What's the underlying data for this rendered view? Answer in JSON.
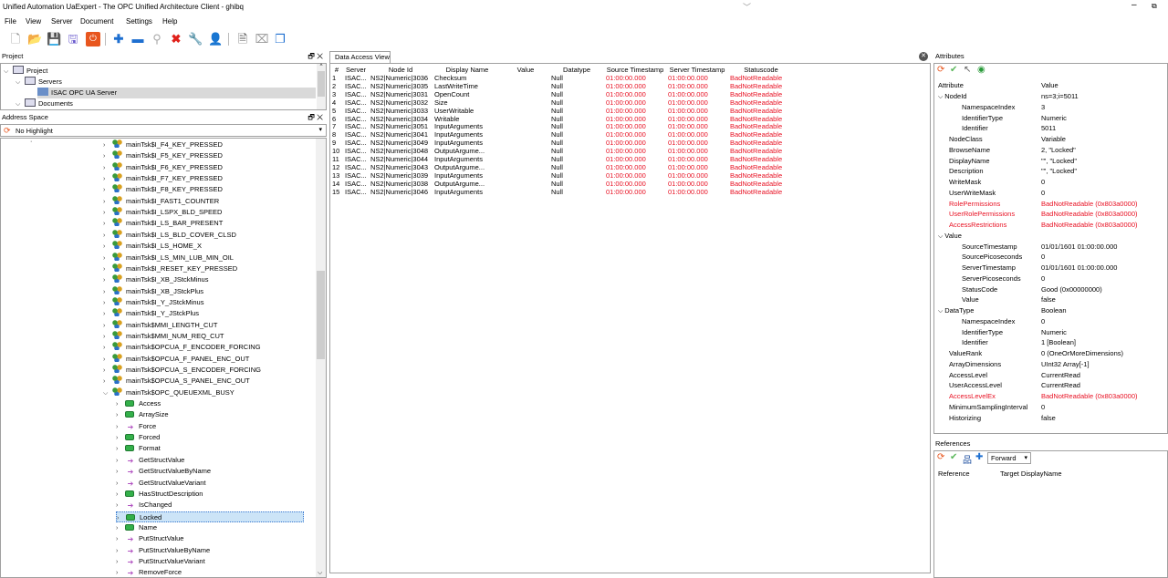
{
  "window": {
    "title": "Unified Automation UaExpert - The OPC Unified Architecture Client - ghibq"
  },
  "menu": [
    "File",
    "View",
    "Server",
    "Document",
    "Settings",
    "Help"
  ],
  "project_panel": {
    "title": "Project",
    "items": [
      {
        "label": "Project",
        "level": 0
      },
      {
        "label": "Servers",
        "level": 1
      },
      {
        "label": "ISAC OPC UA Server",
        "level": 2
      },
      {
        "label": "Documents",
        "level": 1
      }
    ]
  },
  "address_panel": {
    "title": "Address Space",
    "highlight": "No Highlight",
    "items": [
      {
        "label": "mainTsk$I_F4_KEY_PRESSED",
        "kind": "obj",
        "indent": 0
      },
      {
        "label": "mainTsk$I_F5_KEY_PRESSED",
        "kind": "obj",
        "indent": 0
      },
      {
        "label": "mainTsk$I_F6_KEY_PRESSED",
        "kind": "obj",
        "indent": 0
      },
      {
        "label": "mainTsk$I_F7_KEY_PRESSED",
        "kind": "obj",
        "indent": 0
      },
      {
        "label": "mainTsk$I_F8_KEY_PRESSED",
        "kind": "obj",
        "indent": 0
      },
      {
        "label": "mainTsk$I_FAST1_COUNTER",
        "kind": "obj",
        "indent": 0
      },
      {
        "label": "mainTsk$I_LSPX_BLD_SPEED",
        "kind": "obj",
        "indent": 0
      },
      {
        "label": "mainTsk$I_LS_BAR_PRESENT",
        "kind": "obj",
        "indent": 0
      },
      {
        "label": "mainTsk$I_LS_BLD_COVER_CLSD",
        "kind": "obj",
        "indent": 0
      },
      {
        "label": "mainTsk$I_LS_HOME_X",
        "kind": "obj",
        "indent": 0
      },
      {
        "label": "mainTsk$I_LS_MIN_LUB_MIN_OIL",
        "kind": "obj",
        "indent": 0
      },
      {
        "label": "mainTsk$I_RESET_KEY_PRESSED",
        "kind": "obj",
        "indent": 0
      },
      {
        "label": "mainTsk$I_XB_JStckMinus",
        "kind": "obj",
        "indent": 0
      },
      {
        "label": "mainTsk$I_XB_JStckPlus",
        "kind": "obj",
        "indent": 0
      },
      {
        "label": "mainTsk$I_Y_JStckMinus",
        "kind": "obj",
        "indent": 0
      },
      {
        "label": "mainTsk$I_Y_JStckPlus",
        "kind": "obj",
        "indent": 0
      },
      {
        "label": "mainTsk$MMI_LENGTH_CUT",
        "kind": "obj",
        "indent": 0
      },
      {
        "label": "mainTsk$MMI_NUM_REQ_CUT",
        "kind": "obj",
        "indent": 0
      },
      {
        "label": "mainTsk$OPCUA_F_ENCODER_FORCING",
        "kind": "obj",
        "indent": 0
      },
      {
        "label": "mainTsk$OPCUA_F_PANEL_ENC_OUT",
        "kind": "obj",
        "indent": 0
      },
      {
        "label": "mainTsk$OPCUA_S_ENCODER_FORCING",
        "kind": "obj",
        "indent": 0
      },
      {
        "label": "mainTsk$OPCUA_S_PANEL_ENC_OUT",
        "kind": "obj",
        "indent": 0
      },
      {
        "label": "mainTsk$OPC_QUEUEXML_BUSY",
        "kind": "obj",
        "indent": 0,
        "expanded": true
      },
      {
        "label": "Access",
        "kind": "var",
        "indent": 1
      },
      {
        "label": "ArraySize",
        "kind": "var",
        "indent": 1
      },
      {
        "label": "Force",
        "kind": "meth",
        "indent": 1
      },
      {
        "label": "Forced",
        "kind": "var",
        "indent": 1
      },
      {
        "label": "Format",
        "kind": "var",
        "indent": 1
      },
      {
        "label": "GetStructValue",
        "kind": "meth",
        "indent": 1
      },
      {
        "label": "GetStructValueByName",
        "kind": "meth",
        "indent": 1
      },
      {
        "label": "GetStructValueVariant",
        "kind": "meth",
        "indent": 1
      },
      {
        "label": "HasStructDescription",
        "kind": "var",
        "indent": 1
      },
      {
        "label": "IsChanged",
        "kind": "meth",
        "indent": 1
      },
      {
        "label": "Locked",
        "kind": "var",
        "indent": 1,
        "selected": true
      },
      {
        "label": "Name",
        "kind": "var",
        "indent": 1
      },
      {
        "label": "PutStructValue",
        "kind": "meth",
        "indent": 1
      },
      {
        "label": "PutStructValueByName",
        "kind": "meth",
        "indent": 1
      },
      {
        "label": "PutStructValueVariant",
        "kind": "meth",
        "indent": 1
      },
      {
        "label": "RemoveForce",
        "kind": "meth",
        "indent": 1
      }
    ]
  },
  "dav": {
    "tab": "Data Access View",
    "columns": [
      "#",
      "Server",
      "Node Id",
      "Display Name",
      "Value",
      "Datatype",
      "Source Timestamp",
      "Server Timestamp",
      "Statuscode"
    ],
    "rows": [
      [
        "1",
        "ISAC...",
        "NS2|Numeric|3036",
        "Checksum",
        "",
        "Null",
        "01:00:00.000",
        "01:00:00.000",
        "BadNotReadable"
      ],
      [
        "2",
        "ISAC...",
        "NS2|Numeric|3035",
        "LastWriteTime",
        "",
        "Null",
        "01:00:00.000",
        "01:00:00.000",
        "BadNotReadable"
      ],
      [
        "3",
        "ISAC...",
        "NS2|Numeric|3031",
        "OpenCount",
        "",
        "Null",
        "01:00:00.000",
        "01:00:00.000",
        "BadNotReadable"
      ],
      [
        "4",
        "ISAC...",
        "NS2|Numeric|3032",
        "Size",
        "",
        "Null",
        "01:00:00.000",
        "01:00:00.000",
        "BadNotReadable"
      ],
      [
        "5",
        "ISAC...",
        "NS2|Numeric|3033",
        "UserWritable",
        "",
        "Null",
        "01:00:00.000",
        "01:00:00.000",
        "BadNotReadable"
      ],
      [
        "6",
        "ISAC...",
        "NS2|Numeric|3034",
        "Writable",
        "",
        "Null",
        "01:00:00.000",
        "01:00:00.000",
        "BadNotReadable"
      ],
      [
        "7",
        "ISAC...",
        "NS2|Numeric|3051",
        "InputArguments",
        "",
        "Null",
        "01:00:00.000",
        "01:00:00.000",
        "BadNotReadable"
      ],
      [
        "8",
        "ISAC...",
        "NS2|Numeric|3041",
        "InputArguments",
        "",
        "Null",
        "01:00:00.000",
        "01:00:00.000",
        "BadNotReadable"
      ],
      [
        "9",
        "ISAC...",
        "NS2|Numeric|3049",
        "InputArguments",
        "",
        "Null",
        "01:00:00.000",
        "01:00:00.000",
        "BadNotReadable"
      ],
      [
        "10",
        "ISAC...",
        "NS2|Numeric|3048",
        "OutputArgume...",
        "",
        "Null",
        "01:00:00.000",
        "01:00:00.000",
        "BadNotReadable"
      ],
      [
        "11",
        "ISAC...",
        "NS2|Numeric|3044",
        "InputArguments",
        "",
        "Null",
        "01:00:00.000",
        "01:00:00.000",
        "BadNotReadable"
      ],
      [
        "12",
        "ISAC...",
        "NS2|Numeric|3043",
        "OutputArgume...",
        "",
        "Null",
        "01:00:00.000",
        "01:00:00.000",
        "BadNotReadable"
      ],
      [
        "13",
        "ISAC...",
        "NS2|Numeric|3039",
        "InputArguments",
        "",
        "Null",
        "01:00:00.000",
        "01:00:00.000",
        "BadNotReadable"
      ],
      [
        "14",
        "ISAC...",
        "NS2|Numeric|3038",
        "OutputArgume...",
        "",
        "Null",
        "01:00:00.000",
        "01:00:00.000",
        "BadNotReadable"
      ],
      [
        "15",
        "ISAC...",
        "NS2|Numeric|3046",
        "InputArguments",
        "",
        "Null",
        "01:00:00.000",
        "01:00:00.000",
        "BadNotReadable"
      ]
    ]
  },
  "attributes": {
    "title": "Attributes",
    "header": [
      "Attribute",
      "Value"
    ],
    "rows": [
      {
        "name": "NodeId",
        "value": "ns=3;i=5011",
        "level": 0,
        "group": true
      },
      {
        "name": "NamespaceIndex",
        "value": "3",
        "level": 1
      },
      {
        "name": "IdentifierType",
        "value": "Numeric",
        "level": 1
      },
      {
        "name": "Identifier",
        "value": "5011",
        "level": 1
      },
      {
        "name": "NodeClass",
        "value": "Variable",
        "level": 0
      },
      {
        "name": "BrowseName",
        "value": "2, \"Locked\"",
        "level": 0
      },
      {
        "name": "DisplayName",
        "value": "\"\", \"Locked\"",
        "level": 0
      },
      {
        "name": "Description",
        "value": "\"\", \"Locked\"",
        "level": 0
      },
      {
        "name": "WriteMask",
        "value": "0",
        "level": 0
      },
      {
        "name": "UserWriteMask",
        "value": "0",
        "level": 0
      },
      {
        "name": "RolePermissions",
        "value": "BadNotReadable (0x803a0000)",
        "level": 0,
        "error": true
      },
      {
        "name": "UserRolePermissions",
        "value": "BadNotReadable (0x803a0000)",
        "level": 0,
        "error": true
      },
      {
        "name": "AccessRestrictions",
        "value": "BadNotReadable (0x803a0000)",
        "level": 0,
        "error": true
      },
      {
        "name": "Value",
        "value": "",
        "level": 0,
        "group": true
      },
      {
        "name": "SourceTimestamp",
        "value": "01/01/1601 01:00:00.000",
        "level": 1
      },
      {
        "name": "SourcePicoseconds",
        "value": "0",
        "level": 1
      },
      {
        "name": "ServerTimestamp",
        "value": "01/01/1601 01:00:00.000",
        "level": 1
      },
      {
        "name": "ServerPicoseconds",
        "value": "0",
        "level": 1
      },
      {
        "name": "StatusCode",
        "value": "Good (0x00000000)",
        "level": 1
      },
      {
        "name": "Value",
        "value": "false",
        "level": 1
      },
      {
        "name": "DataType",
        "value": "Boolean",
        "level": 0,
        "group": true
      },
      {
        "name": "NamespaceIndex",
        "value": "0",
        "level": 1
      },
      {
        "name": "IdentifierType",
        "value": "Numeric",
        "level": 1
      },
      {
        "name": "Identifier",
        "value": "1 [Boolean]",
        "level": 1
      },
      {
        "name": "ValueRank",
        "value": "0 (OneOrMoreDimensions)",
        "level": 0
      },
      {
        "name": "ArrayDimensions",
        "value": "UInt32 Array[-1]",
        "level": 0
      },
      {
        "name": "AccessLevel",
        "value": "CurrentRead",
        "level": 0
      },
      {
        "name": "UserAccessLevel",
        "value": "CurrentRead",
        "level": 0
      },
      {
        "name": "AccessLevelEx",
        "value": "BadNotReadable (0x803a0000)",
        "level": 0,
        "error": true
      },
      {
        "name": "MinimumSamplingInterval",
        "value": "0",
        "level": 0
      },
      {
        "name": "Historizing",
        "value": "false",
        "level": 0
      }
    ]
  },
  "references": {
    "title": "References",
    "direction": "Forward",
    "header": [
      "Reference",
      "Target DisplayName"
    ]
  },
  "colors": {
    "error": "#e81123",
    "selection": "#cce4f7"
  }
}
